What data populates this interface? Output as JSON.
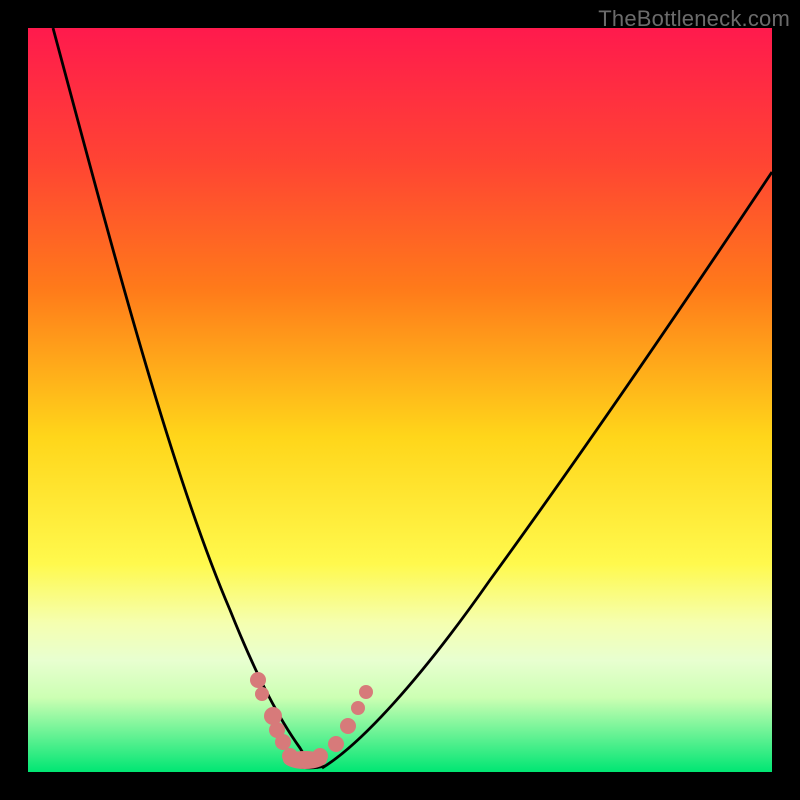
{
  "watermark": "TheBottleneck.com",
  "chart_data": {
    "type": "line",
    "title": "",
    "xlabel": "",
    "ylabel": "",
    "xlim": [
      0,
      100
    ],
    "ylim": [
      0,
      100
    ],
    "grid": false,
    "legend": false,
    "series": [
      {
        "name": "left-curve",
        "x": [
          3,
          6,
          9,
          12,
          15,
          18,
          21,
          24,
          27,
          30,
          32,
          34,
          36,
          38
        ],
        "y": [
          100,
          90,
          79,
          67,
          56,
          45,
          35,
          26,
          18,
          11,
          7,
          4,
          2,
          0
        ]
      },
      {
        "name": "right-curve",
        "x": [
          38,
          41,
          44,
          48,
          52,
          57,
          63,
          70,
          78,
          87,
          98
        ],
        "y": [
          0,
          2,
          5,
          9,
          15,
          22,
          31,
          42,
          54,
          67,
          82
        ]
      },
      {
        "name": "marker-band",
        "x_range": [
          30,
          44
        ],
        "y_range": [
          0,
          12
        ],
        "color": "#d77a7a"
      }
    ],
    "background_gradient": {
      "top": "#ff1a4d",
      "mid_upper": "#ff7a1a",
      "mid": "#ffd61a",
      "mid_lower": "#f8ff66",
      "low": "#ccffb3",
      "bottom": "#00e673"
    },
    "frame_color": "#000000"
  }
}
